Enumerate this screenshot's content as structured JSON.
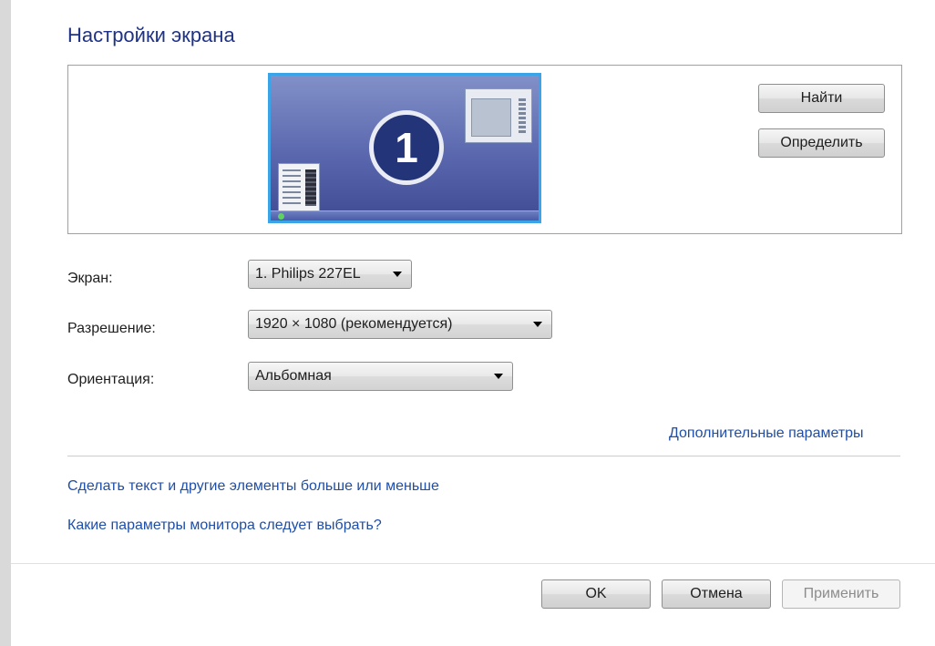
{
  "title": "Настройки экрана",
  "preview": {
    "monitor_number": "1",
    "find_button": "Найти",
    "identify_button": "Определить"
  },
  "fields": {
    "display": {
      "label": "Экран:",
      "value": "1. Philips 227EL"
    },
    "resolution": {
      "label": "Разрешение:",
      "value": "1920 × 1080 (рекомендуется)"
    },
    "orientation": {
      "label": "Ориентация:",
      "value": "Альбомная"
    }
  },
  "links": {
    "advanced": "Дополнительные параметры",
    "text_size": "Сделать текст и другие элементы больше или меньше",
    "which_settings": "Какие параметры монитора следует выбрать?"
  },
  "buttons": {
    "ok": "OK",
    "cancel": "Отмена",
    "apply": "Применить"
  },
  "colors": {
    "title": "#1e3287",
    "link": "#1e4ea8",
    "monitor_border": "#39a5e8",
    "badge": "#243478"
  },
  "icons": {
    "dropdown": "triangle-down"
  }
}
